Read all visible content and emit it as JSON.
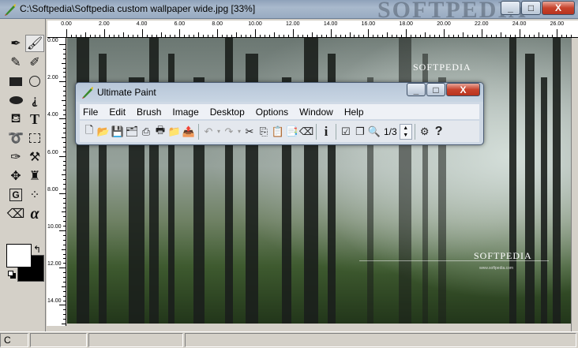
{
  "window": {
    "title": "C:\\Softpedia\\Softpedia custom wallpaper wide.jpg [33%]",
    "titlebar_watermark": "SOFTPEDIA",
    "minimize": "_",
    "maximize": "□",
    "close": "X"
  },
  "rulers": {
    "top": [
      "0.00",
      "2.00",
      "4.00",
      "6.00",
      "8.00",
      "10.00",
      "12.00",
      "14.00",
      "16.00",
      "18.00",
      "20.00",
      "22.00",
      "24.00",
      "26.00"
    ],
    "left": [
      "0.00",
      "2.00",
      "4.00",
      "6.00",
      "8.00",
      "10.00",
      "12.00",
      "14.00"
    ]
  },
  "canvas": {
    "watermark_top": "SOFTPEDIA",
    "watermark_bottom": "SOFTPEDIA",
    "watermark_url": "www.softpedia.com"
  },
  "float_window": {
    "title": "Ultimate Paint",
    "menu": [
      "File",
      "Edit",
      "Brush",
      "Image",
      "Desktop",
      "Options",
      "Window",
      "Help"
    ],
    "page_counter": "1/3"
  },
  "statusbar": {
    "cell1": "C",
    "cell2": "",
    "cell3": "",
    "cell4": ""
  },
  "colors": {
    "foreground": "#ffffff",
    "background": "#000000"
  }
}
